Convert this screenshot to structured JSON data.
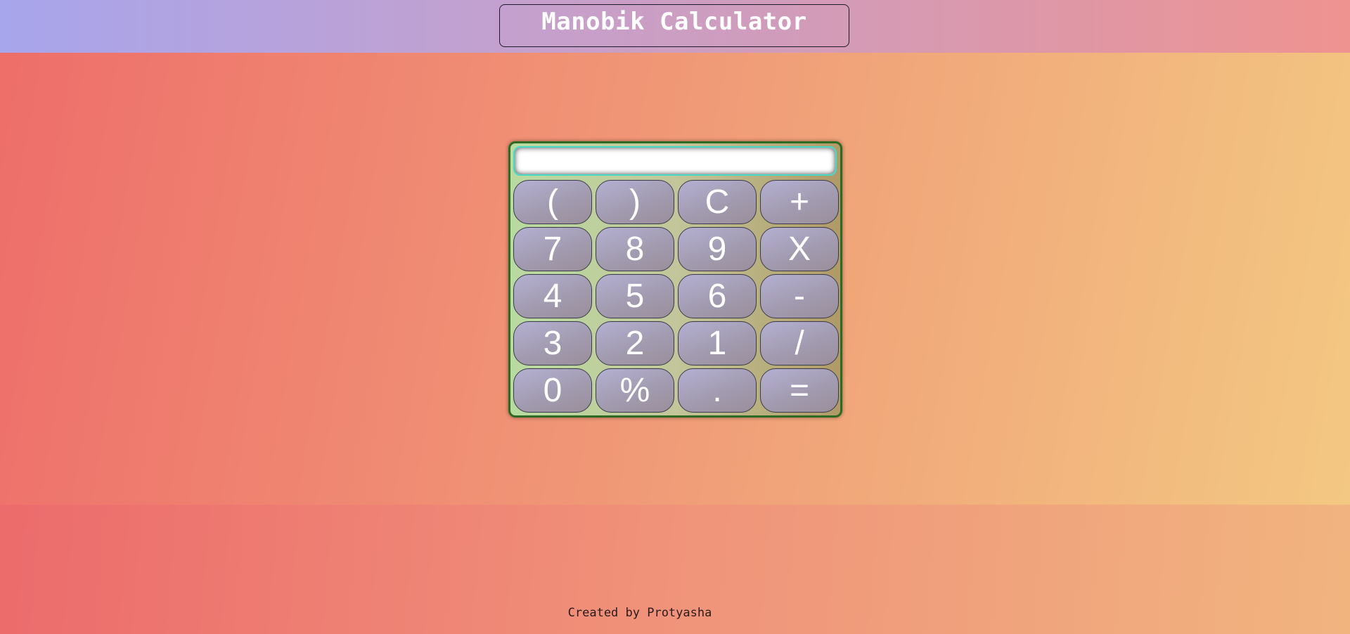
{
  "header": {
    "title": "Manobik Calculator"
  },
  "calculator": {
    "display_value": "",
    "keys": [
      "(",
      ")",
      "C",
      "+",
      "7",
      "8",
      "9",
      "X",
      "4",
      "5",
      "6",
      "-",
      "3",
      "2",
      "1",
      "/",
      "0",
      "%",
      ".",
      "="
    ]
  },
  "footer": {
    "credit": "Created by Protyasha"
  },
  "colors": {
    "header_left": "#a7a5ec",
    "header_right": "#ef9390",
    "main_left": "#ee6e6a",
    "main_right": "#f3c882",
    "calc_border": "#2d6a24",
    "display_border": "#46d9c8",
    "key_fill": "#a29bb0"
  }
}
